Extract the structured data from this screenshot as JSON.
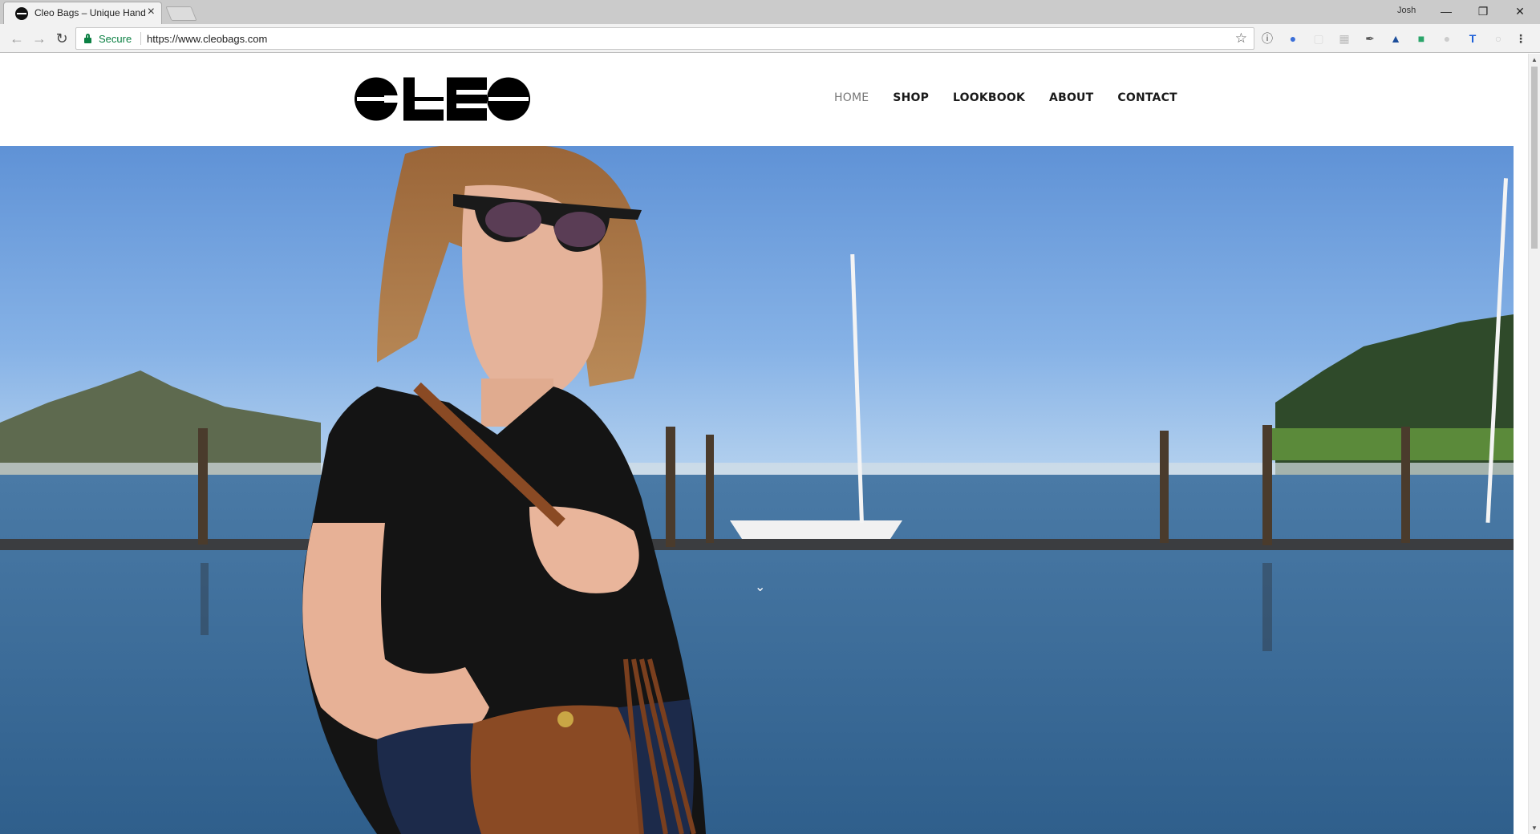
{
  "browser": {
    "tab_title": "Cleo Bags – Unique Handmade Bags",
    "profile_name": "Josh",
    "secure_label": "Secure",
    "url": "https://www.cleobags.com",
    "window_controls": [
      "minimize-icon",
      "restore-icon",
      "close-icon"
    ]
  },
  "site": {
    "logo_text": "CLEO",
    "nav": [
      {
        "label": "HOME",
        "active": true
      },
      {
        "label": "SHOP",
        "active": false
      },
      {
        "label": "LOOKBOOK",
        "active": false
      },
      {
        "label": "ABOUT",
        "active": false
      },
      {
        "label": "CONTACT",
        "active": false
      }
    ],
    "hero": {
      "scroll_icon": "chevron-down-icon"
    }
  },
  "colors": {
    "secure_green": "#0b8043",
    "sky_top": "#5b8dd0",
    "water": "#3f6f9c",
    "leather": "#8a4a24"
  }
}
